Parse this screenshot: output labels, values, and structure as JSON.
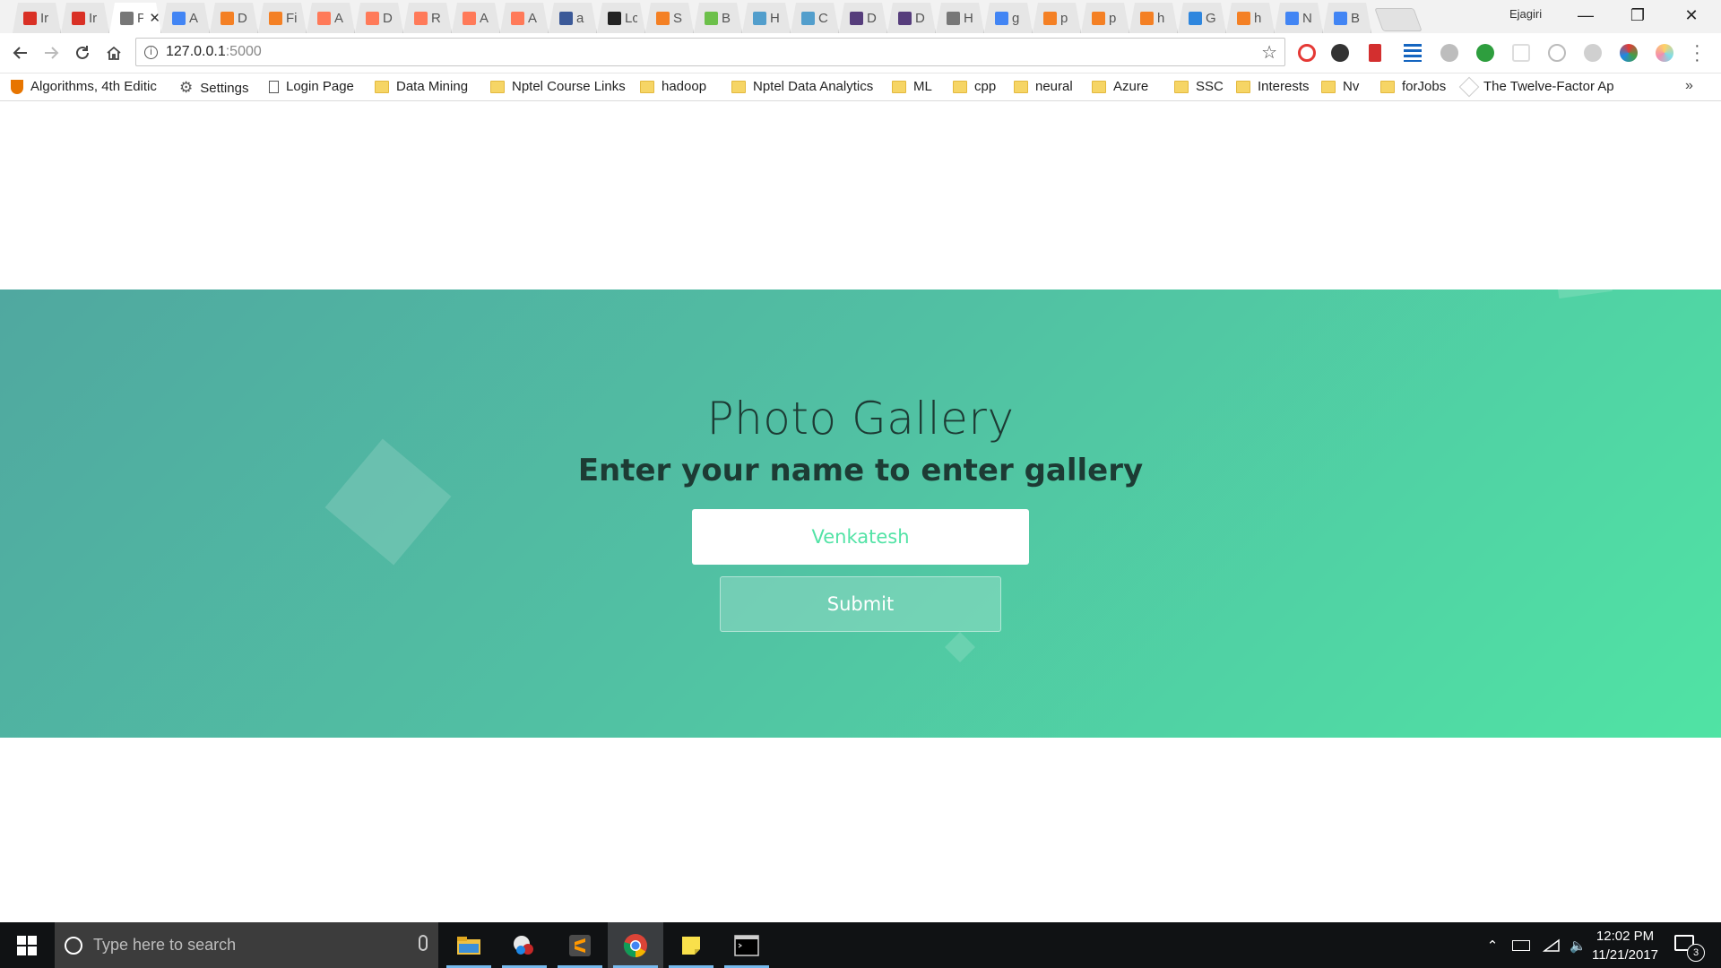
{
  "browser": {
    "profile_name": "Ejagiri",
    "tabs": [
      {
        "title": "Ir",
        "icon": "gmail-icon",
        "color": "#d93025"
      },
      {
        "title": "Ir",
        "icon": "gmail-icon",
        "color": "#d93025"
      },
      {
        "title": "Pl",
        "icon": "page-icon",
        "color": "#777777",
        "active": true
      },
      {
        "title": "A",
        "icon": "docs-icon",
        "color": "#4285f4"
      },
      {
        "title": "D",
        "icon": "cube-icon",
        "color": "#f48024"
      },
      {
        "title": "Fi",
        "icon": "cube-icon",
        "color": "#f48024"
      },
      {
        "title": "A",
        "icon": "hubspot-icon",
        "color": "#ff7a59"
      },
      {
        "title": "D",
        "icon": "hubspot-icon",
        "color": "#ff7a59"
      },
      {
        "title": "R",
        "icon": "hubspot-icon",
        "color": "#ff7a59"
      },
      {
        "title": "A",
        "icon": "hubspot-icon",
        "color": "#ff7a59"
      },
      {
        "title": "A",
        "icon": "hubspot-icon",
        "color": "#ff7a59"
      },
      {
        "title": "a",
        "icon": "facebook-icon",
        "color": "#3b5998"
      },
      {
        "title": "Lc",
        "icon": "github-icon",
        "color": "#222222"
      },
      {
        "title": "S",
        "icon": "cube-icon",
        "color": "#f48024"
      },
      {
        "title": "B",
        "icon": "sheet-icon",
        "color": "#6cc04a"
      },
      {
        "title": "H",
        "icon": "tumblr-icon",
        "color": "#529ecc"
      },
      {
        "title": "C",
        "icon": "tumblr-icon",
        "color": "#529ecc"
      },
      {
        "title": "D",
        "icon": "bootstrap-icon",
        "color": "#563d7c"
      },
      {
        "title": "D",
        "icon": "bootstrap-icon",
        "color": "#563d7c"
      },
      {
        "title": "H",
        "icon": "page-icon",
        "color": "#777777"
      },
      {
        "title": "g",
        "icon": "google-icon",
        "color": "#4285f4"
      },
      {
        "title": "p",
        "icon": "stackoverflow-icon",
        "color": "#f48024"
      },
      {
        "title": "p",
        "icon": "stackoverflow-icon",
        "color": "#f48024"
      },
      {
        "title": "h",
        "icon": "stackoverflow-icon",
        "color": "#f48024"
      },
      {
        "title": "G",
        "icon": "arrow-icon",
        "color": "#2e86de"
      },
      {
        "title": "h",
        "icon": "stackoverflow-icon",
        "color": "#f48024"
      },
      {
        "title": "N",
        "icon": "mdb-icon",
        "color": "#4285f4"
      },
      {
        "title": "B",
        "icon": "mdb-icon",
        "color": "#4285f4"
      }
    ],
    "tab_close_symbol": "✕",
    "window_controls": {
      "minimize": "—",
      "restore": "❐",
      "close": "✕"
    },
    "address": {
      "host": "127.0.0.1",
      "port": ":5000"
    },
    "bookmarks": [
      {
        "label": "Algorithms, 4th Editic",
        "icon": "princeton-icon"
      },
      {
        "label": "Settings",
        "icon": "gear-icon"
      },
      {
        "label": "Login Page",
        "icon": "page-icon"
      },
      {
        "label": "Data Mining",
        "icon": "folder-icon"
      },
      {
        "label": "Nptel Course Links",
        "icon": "folder-icon"
      },
      {
        "label": "hadoop",
        "icon": "folder-icon"
      },
      {
        "label": "Nptel Data Analytics",
        "icon": "folder-icon"
      },
      {
        "label": "ML",
        "icon": "folder-icon"
      },
      {
        "label": "cpp",
        "icon": "folder-icon"
      },
      {
        "label": "neural",
        "icon": "folder-icon"
      },
      {
        "label": "Azure",
        "icon": "folder-icon"
      },
      {
        "label": "SSC",
        "icon": "folder-icon"
      },
      {
        "label": "Interests",
        "icon": "folder-icon"
      },
      {
        "label": "Nv",
        "icon": "folder-icon"
      },
      {
        "label": "forJobs",
        "icon": "folder-icon"
      },
      {
        "label": "The Twelve-Factor Ap",
        "icon": "twelve-factor-icon"
      }
    ],
    "bookmarks_overflow": "»"
  },
  "page": {
    "title": "Photo Gallery",
    "subtitle": "Enter your name to enter gallery",
    "name_input_value": "Venkatesh",
    "submit_label": "Submit",
    "gradient_colors": [
      "#50a8a0",
      "#50e3a4"
    ]
  },
  "taskbar": {
    "search_placeholder": "Type here to search",
    "time": "12:02 PM",
    "date": "11/21/2017",
    "notification_count": "3"
  }
}
